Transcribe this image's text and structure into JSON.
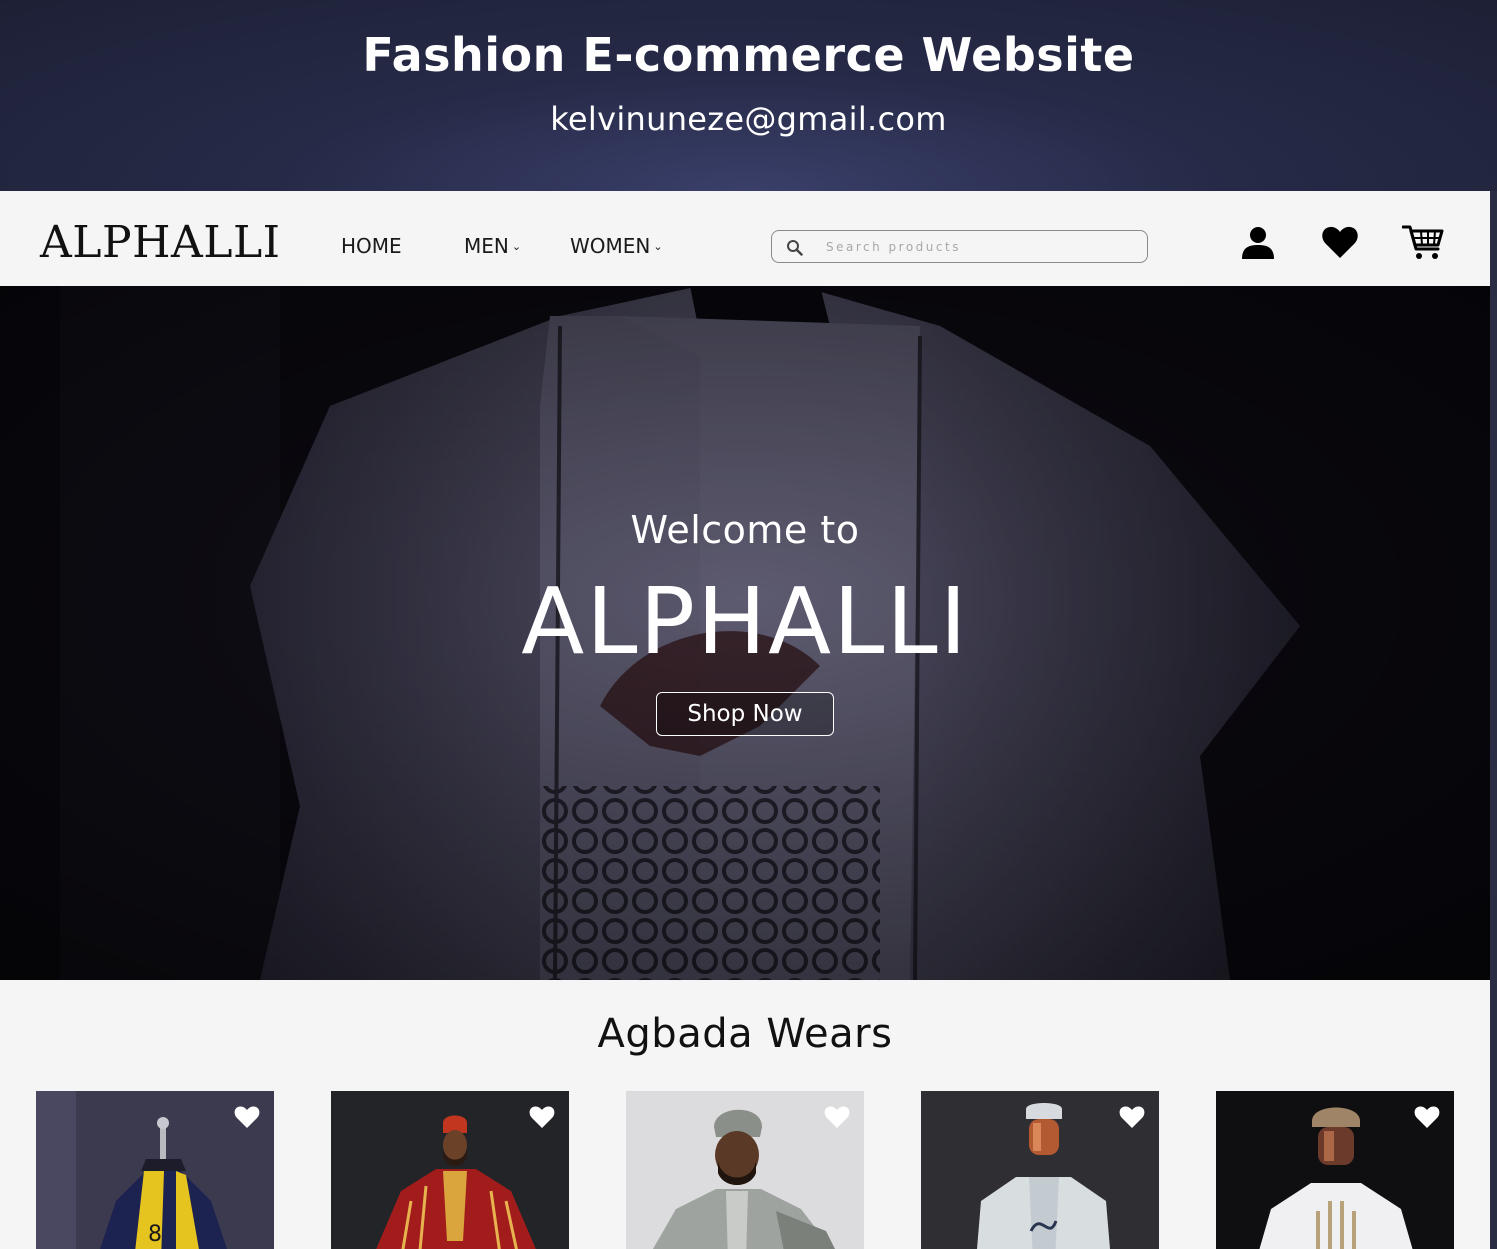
{
  "banner": {
    "title": "Fashion E-commerce Website",
    "email": "kelvinuneze@gmail.com"
  },
  "navbar": {
    "logo": "ALPHALLI",
    "links": [
      {
        "label": "HOME",
        "has_dropdown": false
      },
      {
        "label": "MEN",
        "has_dropdown": true
      },
      {
        "label": "WOMEN",
        "has_dropdown": true
      }
    ],
    "dropdown_glyph": "⌄",
    "search_placeholder": "Search products",
    "icons": [
      "user-icon",
      "heart-icon",
      "cart-icon"
    ]
  },
  "hero": {
    "welcome": "Welcome to",
    "brand": "ALPHALLI",
    "cta_label": "Shop Now"
  },
  "section": {
    "title": "Agbada Wears",
    "products": [
      {
        "image": "navy-agbada-mannequin",
        "accent": "#e6c41f"
      },
      {
        "image": "red-striped-agbada-model",
        "accent": "#b3201c"
      },
      {
        "image": "grey-agbada-model",
        "accent": "#9fa39f"
      },
      {
        "image": "white-agbada-mannequin",
        "accent": "#d8dde0"
      },
      {
        "image": "white-embroidered-agbada-mannequin",
        "accent": "#f0f0f2"
      }
    ]
  },
  "colors": {
    "banner_bg": "#262a47",
    "page_bg": "#f5f5f5",
    "hero_bg": "#0f0d16",
    "text_dark": "#111111",
    "text_light": "#ffffff"
  }
}
